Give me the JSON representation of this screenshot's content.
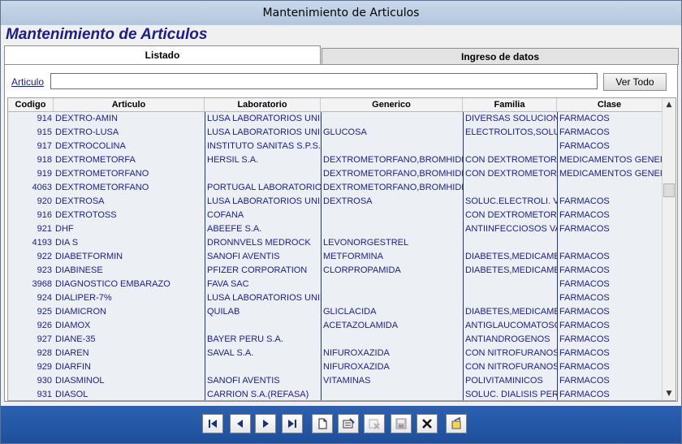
{
  "window": {
    "title": "Mantenimiento de Articulos"
  },
  "header": {
    "title": "Mantenimiento de Articulos"
  },
  "tabs": [
    {
      "label": "Listado",
      "active": true
    },
    {
      "label": "Ingreso de datos",
      "active": false
    }
  ],
  "search": {
    "label": "Articulo",
    "value": "",
    "button_label": "Ver Todo"
  },
  "table": {
    "columns": [
      "Codigo",
      "Articulo",
      "Laboratorio",
      "Generico",
      "Familia",
      "Clase"
    ],
    "rows": [
      [
        "914",
        "DEXTRO-AMIN",
        "LUSA LABORATORIOS UNID",
        "",
        "DIVERSAS SOLUCIONE",
        "FARMACOS"
      ],
      [
        "915",
        "DEXTRO-LUSA",
        "LUSA LABORATORIOS UNID",
        "GLUCOSA",
        "ELECTROLITOS,SOLUC",
        "FARMACOS"
      ],
      [
        "917",
        "DEXTROCOLINA",
        "INSTITUTO SANITAS S.P.S.A",
        "",
        "",
        "FARMACOS"
      ],
      [
        "918",
        "DEXTROMETORFA",
        "HERSIL S.A.",
        "DEXTROMETORFANO,BROMHIDRAT",
        "CON DEXTROMETORFA",
        "MEDICAMENTOS GENERICO"
      ],
      [
        "919",
        "DEXTROMETORFANO",
        "",
        "DEXTROMETORFANO,BROMHIDRAT",
        "CON DEXTROMETORFA",
        "MEDICAMENTOS GENERICO"
      ],
      [
        "4063",
        "DEXTROMETORFANO",
        "PORTUGAL LABORATORIOS",
        "DEXTROMETORFANO,BROMHIDRAT",
        "",
        ""
      ],
      [
        "920",
        "DEXTROSA",
        "LUSA LABORATORIOS UNID",
        "DEXTROSA",
        "SOLUC.ELECTROLI. VE",
        "FARMACOS"
      ],
      [
        "916",
        "DEXTROTOSS",
        "COFANA",
        "",
        "CON DEXTROMETORFA",
        "FARMACOS"
      ],
      [
        "921",
        "DHF",
        "ABEEFE S.A.",
        "",
        "ANTIINFECCIOSOS VAC",
        "FARMACOS"
      ],
      [
        "4193",
        "DIA S",
        "DRONNVELS MEDROCK",
        "LEVONORGESTREL",
        "",
        ""
      ],
      [
        "922",
        "DIABETFORMIN",
        "SANOFI AVENTIS",
        "METFORMINA",
        "DIABETES,MEDICAMENT",
        "FARMACOS"
      ],
      [
        "923",
        "DIABINESE",
        "PFIZER CORPORATION",
        "CLORPROPAMIDA",
        "DIABETES,MEDICAMENT",
        "FARMACOS"
      ],
      [
        "3968",
        "DIAGNOSTICO EMBARAZO",
        "FAVA SAC",
        "",
        "",
        "FARMACOS"
      ],
      [
        "924",
        "DIALIPER-7%",
        "LUSA LABORATORIOS UNID",
        "",
        "",
        "FARMACOS"
      ],
      [
        "925",
        "DIAMICRON",
        "QUILAB",
        "GLICLACIDA",
        "DIABETES,MEDICAMENT",
        "FARMACOS"
      ],
      [
        "926",
        "DIAMOX",
        "",
        "ACETAZOLAMIDA",
        "ANTIGLAUCOMATOSO",
        "FARMACOS"
      ],
      [
        "927",
        "DIANE-35",
        "BAYER PERU S.A.",
        "",
        "ANTIANDROGENOS",
        "FARMACOS"
      ],
      [
        "928",
        "DIAREN",
        "SAVAL S.A.",
        "NIFUROXAZIDA",
        "CON NITROFURANOS",
        "FARMACOS"
      ],
      [
        "929",
        "DIARFIN",
        "",
        "NIFUROXAZIDA",
        "CON NITROFURANOS",
        "FARMACOS"
      ],
      [
        "930",
        "DIASMINOL",
        "SANOFI AVENTIS",
        "VITAMINAS",
        "POLIVITAMINICOS",
        "FARMACOS"
      ],
      [
        "931",
        "DIASOL",
        "CARRION S.A.(REFASA)",
        "",
        "SOLUC. DIALISIS PERIT",
        "FARMACOS"
      ]
    ]
  },
  "toolbar": {
    "buttons": [
      "first-record",
      "previous-record",
      "next-record",
      "last-record",
      "new-record",
      "edit-record",
      "delete-record",
      "save-record",
      "cancel",
      "exit"
    ]
  }
}
